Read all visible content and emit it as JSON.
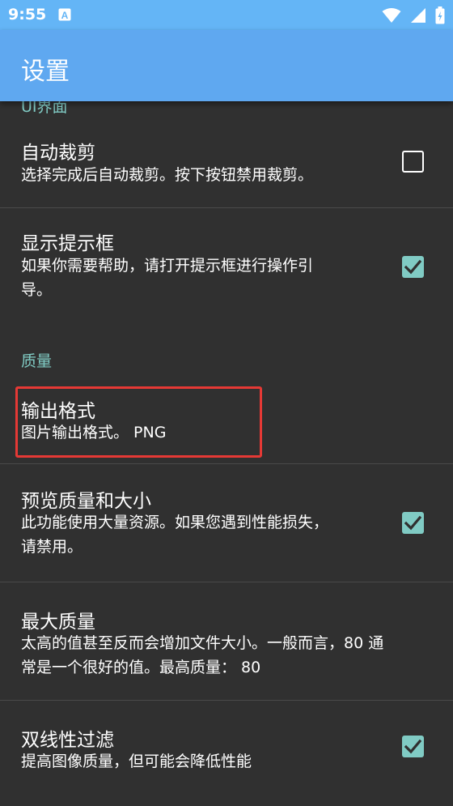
{
  "status_bar": {
    "time": "9:55",
    "icons": [
      "notification-a-icon",
      "wifi-icon",
      "signal-icon",
      "battery-icon"
    ]
  },
  "app_bar": {
    "title": "设置"
  },
  "sections": {
    "ui": {
      "header": "UI界面"
    },
    "quality": {
      "header": "质量"
    }
  },
  "prefs": {
    "auto_crop": {
      "title": "自动裁剪",
      "summary": "选择完成后自动裁剪。按下按钮禁用裁剪。",
      "checked": false
    },
    "show_hints": {
      "title": "显示提示框",
      "summary_line1": "如果你需要帮助，请打开提示框进行操作引",
      "summary_line2": "导。",
      "checked": true
    },
    "output_format": {
      "title": "输出格式",
      "summary": "图片输出格式。 PNG"
    },
    "preview_quality": {
      "title": "预览质量和大小",
      "summary_line1": "此功能使用大量资源。如果您遇到性能损失，",
      "summary_line2": "请禁用。",
      "checked": true
    },
    "max_quality": {
      "title": "最大质量",
      "summary_line1": "太高的值甚至反而会增加文件大小。一般而言，80 通",
      "summary_line2": "常是一个很好的值。最高质量： 80"
    },
    "bilinear_filter": {
      "title": "双线性过滤",
      "summary": "提高图像质量，但可能会降低性能",
      "checked": true
    }
  },
  "colors": {
    "app_bar": "#5FA8F0",
    "status_bar": "#64B5F6",
    "background": "#303030",
    "accent": "#80CBC4",
    "highlight": "#E53935"
  }
}
